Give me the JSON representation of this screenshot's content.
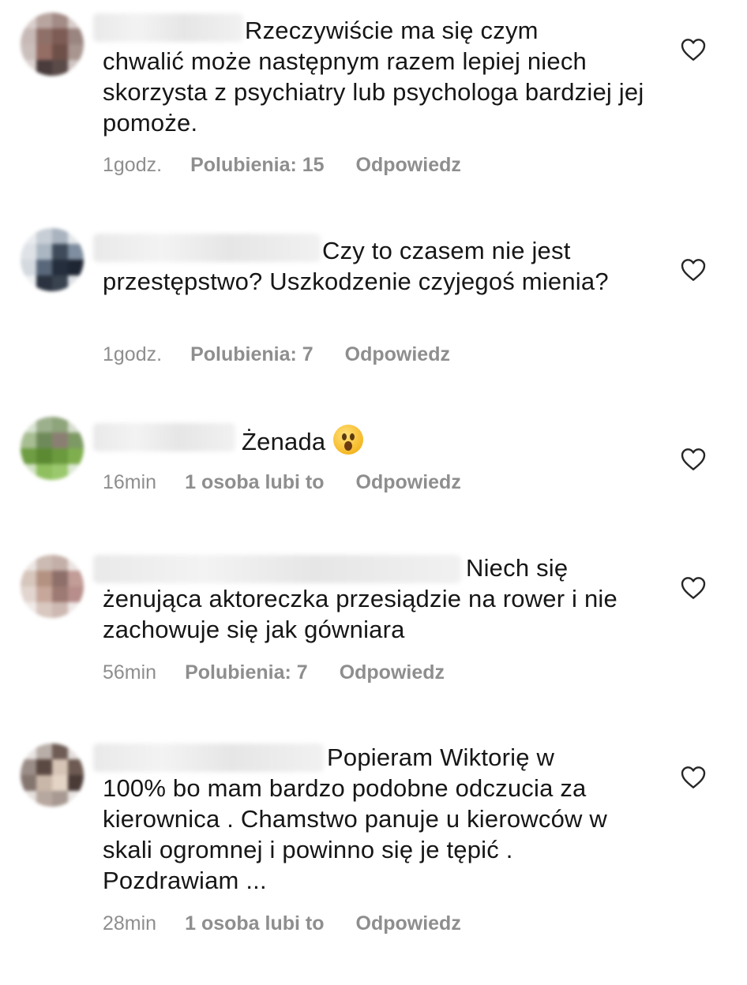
{
  "comments": [
    {
      "text_first": "Rzeczywiście ma się czym",
      "text_rest": "chwalić może następnym razem lepiej niech skorzysta z psychiatry lub psychologa bardziej jej pomoże.",
      "time": "1godz.",
      "likes": "Polubienia: 15",
      "reply": "Odpowiedz",
      "icon": "heart-outline-icon"
    },
    {
      "text_first": "Czy to czasem nie jest",
      "text_rest": "przestępstwo? Uszkodzenie czyjegoś mienia?",
      "time": "1godz.",
      "likes": "Polubienia: 7",
      "reply": "Odpowiedz",
      "icon": "heart-outline-icon"
    },
    {
      "text_first": "Żenada",
      "text_rest": "",
      "emoji": "astonished-face-emoji",
      "time": "16min",
      "likes": "1 osoba lubi to",
      "reply": "Odpowiedz",
      "icon": "heart-outline-icon"
    },
    {
      "text_first": "Niech się",
      "text_rest": "żenująca aktoreczka przesiądzie na rower i nie zachowuje się jak gówniara",
      "time": "56min",
      "likes": "Polubienia: 7",
      "reply": "Odpowiedz",
      "icon": "heart-outline-icon"
    },
    {
      "text_first": "Popieram Wiktorię w",
      "text_rest": "100% bo mam bardzo podobne odczucia za kierownica . Chamstwo panuje u kierowców w skali ogromnej  i powinno się je tępić . Pozdrawiam ...",
      "time": "28min",
      "likes": "1 osoba lubi to",
      "reply": "Odpowiedz",
      "icon": "heart-outline-icon"
    }
  ],
  "colors": {
    "text": "#161616",
    "meta": "#8e8e8e",
    "heart_stroke": "#262626"
  }
}
